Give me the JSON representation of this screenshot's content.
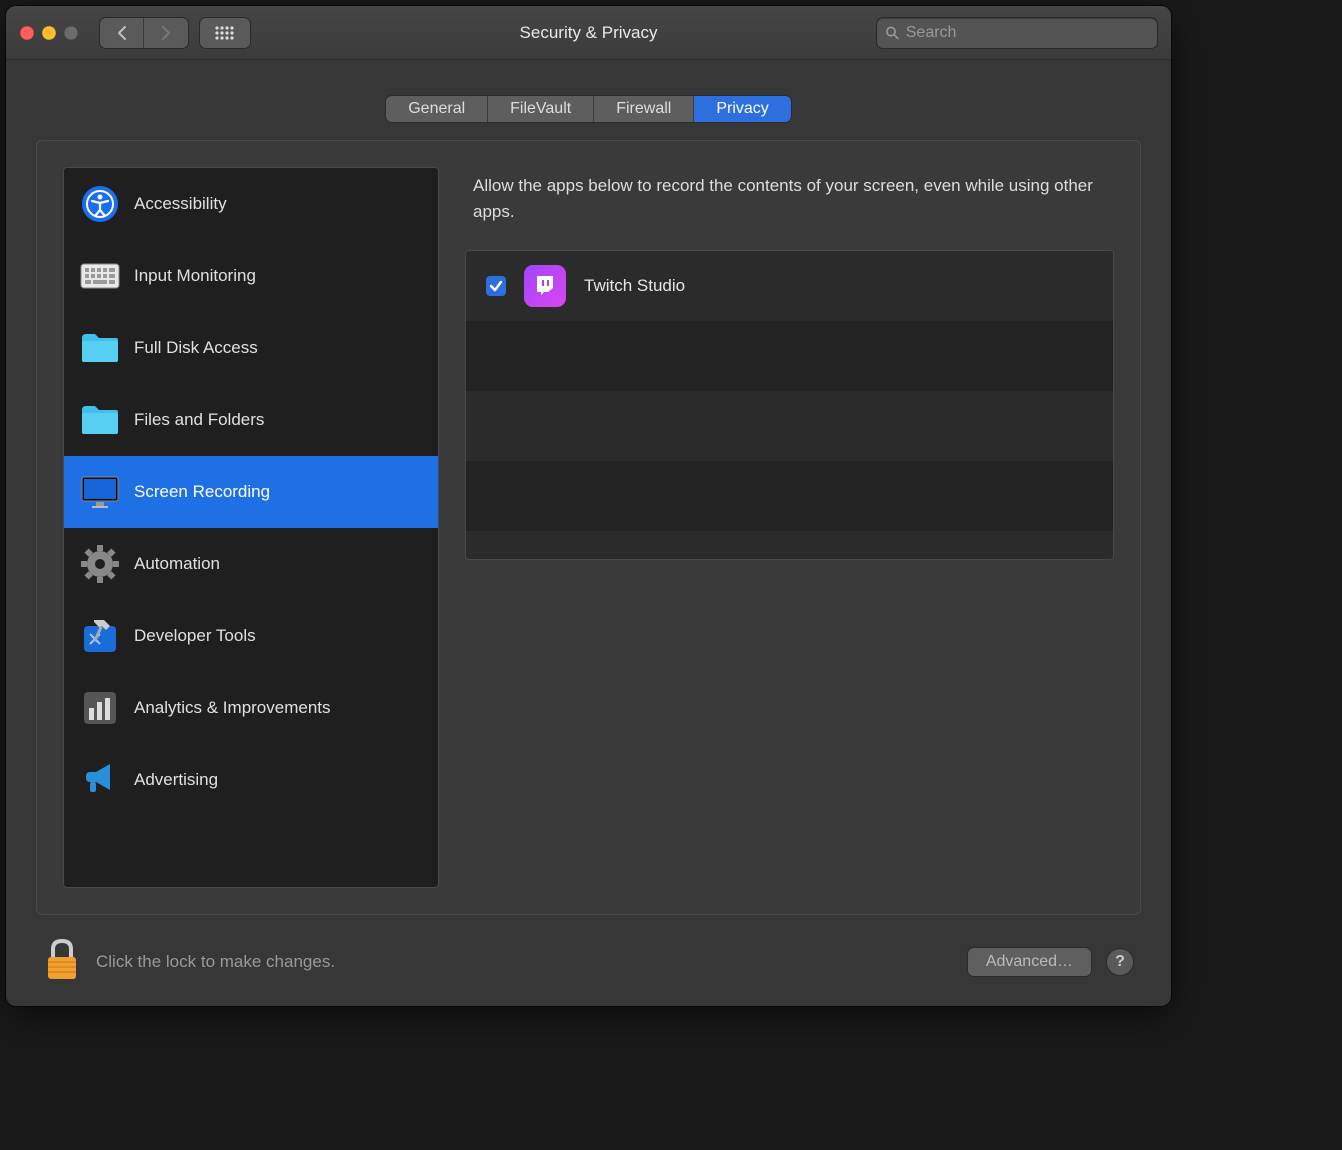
{
  "window": {
    "title": "Security & Privacy"
  },
  "search": {
    "placeholder": "Search"
  },
  "tabs": [
    {
      "label": "General",
      "active": false
    },
    {
      "label": "FileVault",
      "active": false
    },
    {
      "label": "Firewall",
      "active": false
    },
    {
      "label": "Privacy",
      "active": true
    }
  ],
  "sidebar": {
    "items": [
      {
        "label": "Accessibility",
        "icon": "accessibility-icon",
        "selected": false
      },
      {
        "label": "Input Monitoring",
        "icon": "keyboard-icon",
        "selected": false
      },
      {
        "label": "Full Disk Access",
        "icon": "folder-icon",
        "selected": false
      },
      {
        "label": "Files and Folders",
        "icon": "folder-icon",
        "selected": false
      },
      {
        "label": "Screen Recording",
        "icon": "display-icon",
        "selected": true
      },
      {
        "label": "Automation",
        "icon": "gear-icon",
        "selected": false
      },
      {
        "label": "Developer Tools",
        "icon": "hammer-icon",
        "selected": false
      },
      {
        "label": "Analytics & Improvements",
        "icon": "chart-icon",
        "selected": false
      },
      {
        "label": "Advertising",
        "icon": "megaphone-icon",
        "selected": false
      }
    ]
  },
  "detail": {
    "description": "Allow the apps below to record the contents of your screen, even while using other apps.",
    "apps": [
      {
        "name": "Twitch Studio",
        "checked": true
      }
    ]
  },
  "footer": {
    "lock_text": "Click the lock to make changes.",
    "advanced_label": "Advanced…"
  }
}
